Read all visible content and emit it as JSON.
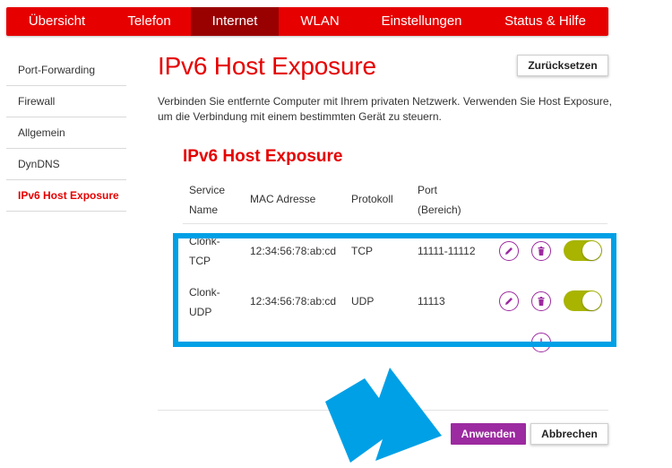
{
  "nav": {
    "tabs": [
      {
        "label": "Übersicht"
      },
      {
        "label": "Telefon"
      },
      {
        "label": "Internet",
        "active": true
      },
      {
        "label": "WLAN"
      },
      {
        "label": "Einstellungen"
      },
      {
        "label": "Status & Hilfe"
      }
    ]
  },
  "sidebar": {
    "items": [
      {
        "label": "Port-Forwarding"
      },
      {
        "label": "Firewall"
      },
      {
        "label": "Allgemein"
      },
      {
        "label": "DynDNS"
      },
      {
        "label": "IPv6 Host Exposure",
        "active": true
      }
    ]
  },
  "page": {
    "title": "IPv6 Host Exposure",
    "reset_label": "Zurücksetzen",
    "description": "Verbinden Sie entfernte Computer mit Ihrem privaten Netzwerk. Verwenden Sie Host Exposure, um die Verbindung mit einem bestimmten Gerät zu steuern.",
    "section_title": "IPv6 Host Exposure"
  },
  "table": {
    "headers": {
      "service_line1": "Service",
      "service_line2": "Name",
      "mac": "MAC Adresse",
      "protocol": "Protokoll",
      "port_line1": "Port",
      "port_line2": "(Bereich)"
    },
    "rows": [
      {
        "service_line1": "Clonk-",
        "service_line2": "TCP",
        "mac": "12:34:56:78:ab:cd",
        "protocol": "TCP",
        "port": "11111-11112",
        "enabled": true
      },
      {
        "service_line1": "Clonk-",
        "service_line2": "UDP",
        "mac": "12:34:56:78:ab:cd",
        "protocol": "UDP",
        "port": "11113",
        "enabled": true
      }
    ]
  },
  "footer": {
    "apply_label": "Anwenden",
    "cancel_label": "Abbrechen"
  },
  "colors": {
    "brand_red": "#e60000",
    "nav_active": "#990000",
    "accent_purple": "#9c2aa0",
    "toggle_on": "#a8b400",
    "highlight_blue": "#00a0e6"
  },
  "icons": [
    "edit-icon",
    "delete-icon",
    "add-icon",
    "arrow-annotation"
  ]
}
